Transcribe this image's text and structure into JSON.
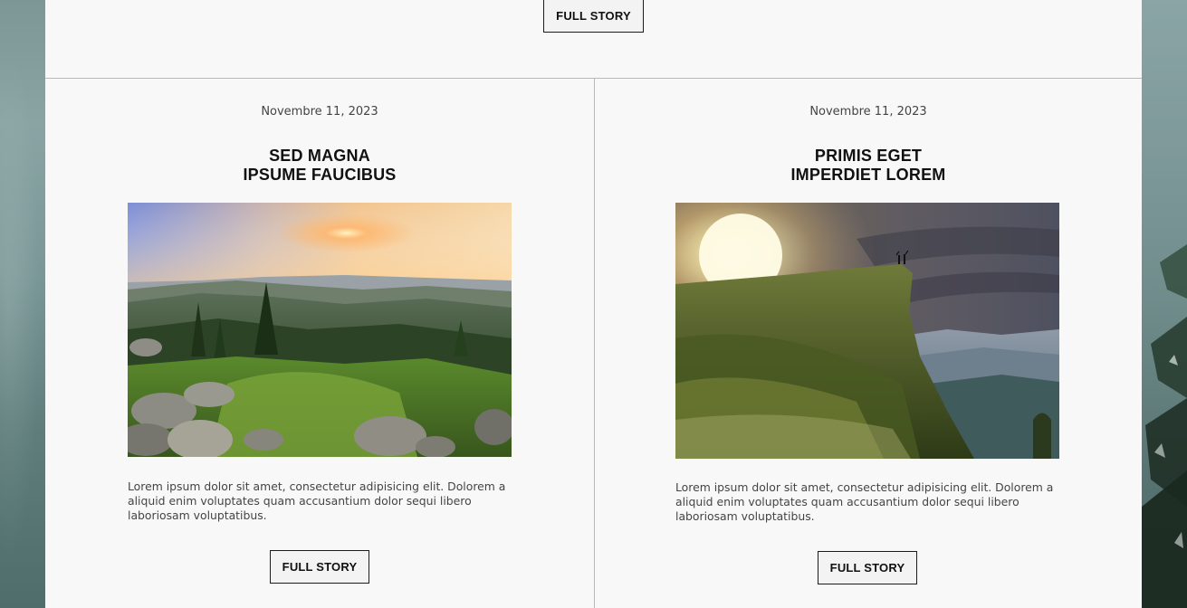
{
  "top": {
    "button_label": "FULL STORY"
  },
  "posts": [
    {
      "date": "Novembre 11, 2023",
      "title_line1": "SED MAGNA",
      "title_line2": "IPSUME FAUCIBUS",
      "image_icon": "mountain-sunset-landscape",
      "excerpt": "Lorem ipsum dolor sit amet, consectetur adipisicing elit. Dolorem a aliquid enim voluptates quam accusantium dolor sequi libero laboriosam voluptatibus.",
      "button_label": "FULL STORY"
    },
    {
      "date": "Novembre 11, 2023",
      "title_line1": "PRIMIS EGET",
      "title_line2": "IMPERDIET LOREM",
      "image_icon": "cliff-hikers-sunrise",
      "excerpt": "Lorem ipsum dolor sit amet, consectetur adipisicing elit. Dolorem a aliquid enim voluptates quam accusantium dolor sequi libero laboriosam voluptatibus.",
      "button_label": "FULL STORY"
    }
  ],
  "colors": {
    "panel_bg": "#f8f8f8",
    "button_border": "#1c1c1c",
    "text_dark": "#111111",
    "text_muted": "#444444"
  }
}
